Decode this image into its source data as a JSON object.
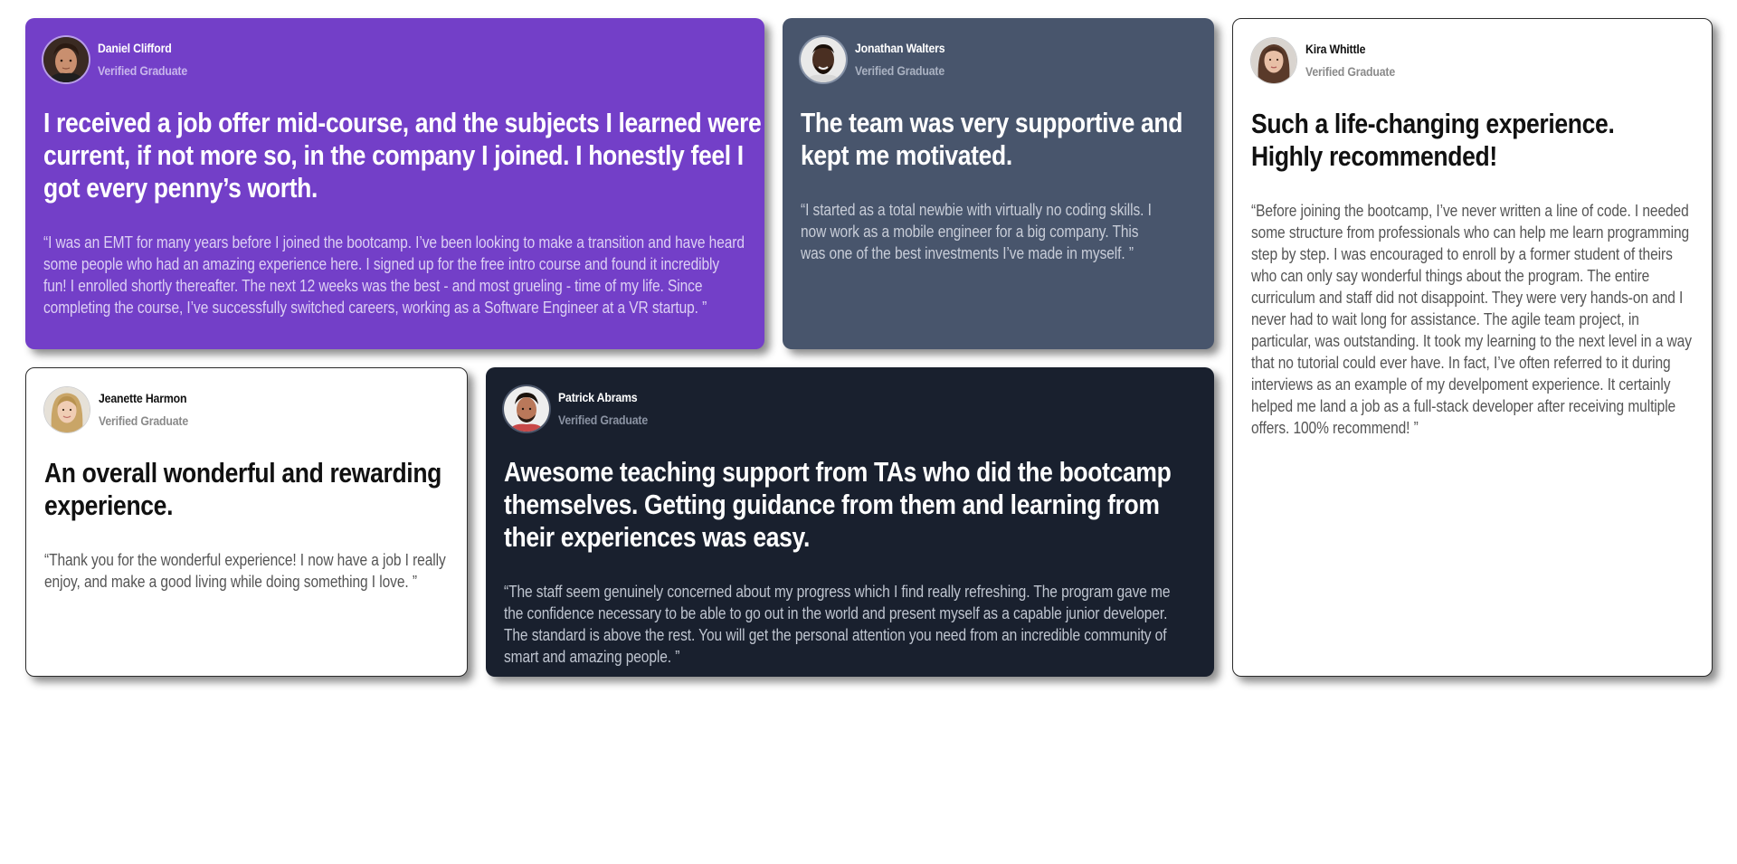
{
  "colors": {
    "purple": "#733fc8",
    "slate": "#48556c",
    "white": "#ffffff",
    "dark": "#19202e",
    "border": "#2b2b2b"
  },
  "testimonials": [
    {
      "name": "Daniel Clifford",
      "role": "Verified Graduate",
      "avatar": "daniel-clifford-avatar",
      "headline": "I received a job offer mid-course, and the subjects I learned were current, if not more so, in the company I joined. I honestly feel I got every penny’s worth.",
      "quote": "“I was an EMT for many years before I joined the bootcamp. I’ve been looking to make a transition and have heard some people who had an amazing experience here. I signed up for the free intro course and found it incredibly fun! I enrolled shortly thereafter. The next 12 weeks was the best - and most grueling - time of my life. Since completing the course, I’ve successfully switched careers, working as a Software Engineer at a VR startup. ”"
    },
    {
      "name": "Jonathan Walters",
      "role": "Verified Graduate",
      "avatar": "jonathan-walters-avatar",
      "headline": "The team was very supportive and kept me motivated.",
      "quote": "“I started as a total newbie with virtually no coding skills. I now work as a mobile engineer for a big company. This was one of the best investments I’ve made in myself. ”"
    },
    {
      "name": "Kira Whittle",
      "role": "Verified Graduate",
      "avatar": "kira-whittle-avatar",
      "headline": "Such a life-changing experience. Highly recommended!",
      "quote": "“Before joining the bootcamp, I’ve never written a line of code. I needed some structure from professionals who can help me learn programming step by step. I was encouraged to enroll by a former student of theirs who can only say wonderful things about the program. The entire curriculum and staff did not disappoint. They were very hands-on and I never had to wait long for assistance. The agile team project, in particular, was outstanding. It took my learning to the next level in a way that no tutorial could ever have. In fact, I’ve often referred to it during interviews as an example of my develpoment experience. It certainly helped me land a job as a full-stack developer after receiving multiple offers. 100% recommend! ”"
    },
    {
      "name": "Jeanette Harmon",
      "role": "Verified Graduate",
      "avatar": "jeanette-harmon-avatar",
      "headline": "An overall wonderful and rewarding experience.",
      "quote": "“Thank you for the wonderful experience! I now have a job I really enjoy, and make a good living while doing something I love. ”"
    },
    {
      "name": "Patrick Abrams",
      "role": "Verified Graduate",
      "avatar": "patrick-abrams-avatar",
      "headline": "Awesome teaching support from TAs who did the bootcamp themselves. Getting guidance from them and learning from their experiences was easy.",
      "quote": "“The staff seem genuinely concerned about my progress which I find really refreshing. The program gave me the confidence necessary to be able to go out in the world and present myself as a capable junior developer. The standard is above the rest. You will get the personal attention you need from an incredible community of smart and amazing people. ”"
    }
  ]
}
